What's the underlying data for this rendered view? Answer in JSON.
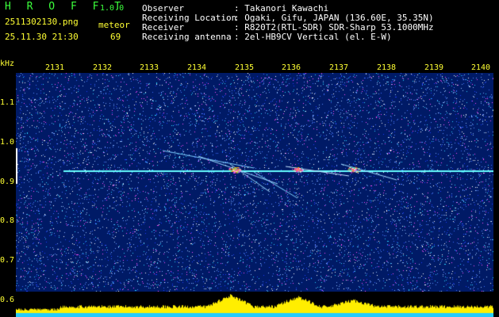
{
  "header": {
    "app_title": "H R O F F T",
    "version": "1.0.0",
    "filename": "2511302130.png",
    "type_label": "meteor",
    "datetime": "25.11.30 21:30",
    "count": "69",
    "observer_label": "Observer",
    "observer_value": ": Takanori Kawachi",
    "location_label": "Receiving Location",
    "location_value": ": Ogaki, Gifu, JAPAN (136.60E, 35.35N)",
    "receiver_label": "Receiver",
    "receiver_value": ": R820T2(RTL-SDR) SDR-Sharp 53.1000MHz",
    "antenna_label": "Receiving antenna",
    "antenna_value": ": 2el-HB9CV Vertical (el. E-W)"
  },
  "axis": {
    "unit": "kHz",
    "y_ticks": [
      "1.1",
      "1.0",
      "0.9",
      "0.8",
      "0.7",
      "0.6"
    ],
    "time_ticks": [
      "2131",
      "2132",
      "2133",
      "2134",
      "2135",
      "2136",
      "2137",
      "2138",
      "2139",
      "2140"
    ]
  },
  "colors": {
    "background": "#001a66",
    "carrier": "#66ffff",
    "header_green": "#3cff3c",
    "header_yellow": "#ffff33"
  }
}
